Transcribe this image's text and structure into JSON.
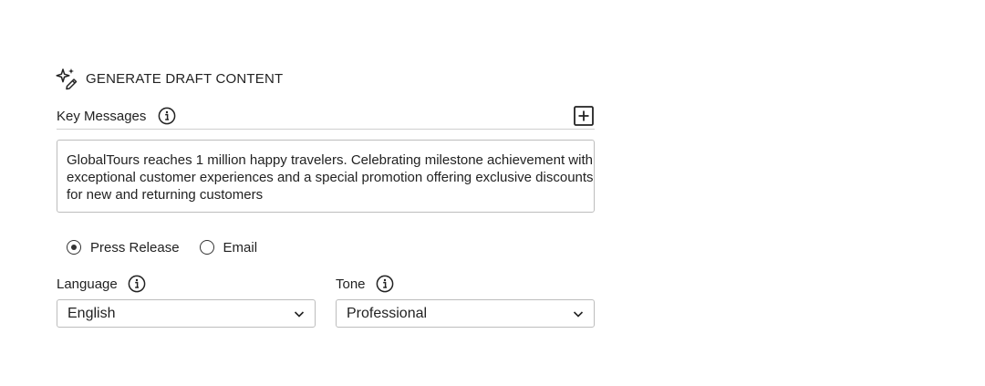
{
  "section": {
    "title": "GENERATE DRAFT CONTENT"
  },
  "key_messages": {
    "label": "Key Messages",
    "text": "GlobalTours reaches 1 million happy travelers. Celebrating milestone achievement with exceptional customer experiences and a special promotion offering exclusive discounts for new and returning customers"
  },
  "content_type": {
    "options": [
      {
        "label": "Press Release",
        "selected": true
      },
      {
        "label": "Email",
        "selected": false
      }
    ]
  },
  "language": {
    "label": "Language",
    "value": "English"
  },
  "tone": {
    "label": "Tone",
    "value": "Professional"
  },
  "icons": {
    "header": "sparkle-pen-icon",
    "info": "info-icon",
    "add": "add-square-icon",
    "dropdown": "chevron-down-icon"
  }
}
